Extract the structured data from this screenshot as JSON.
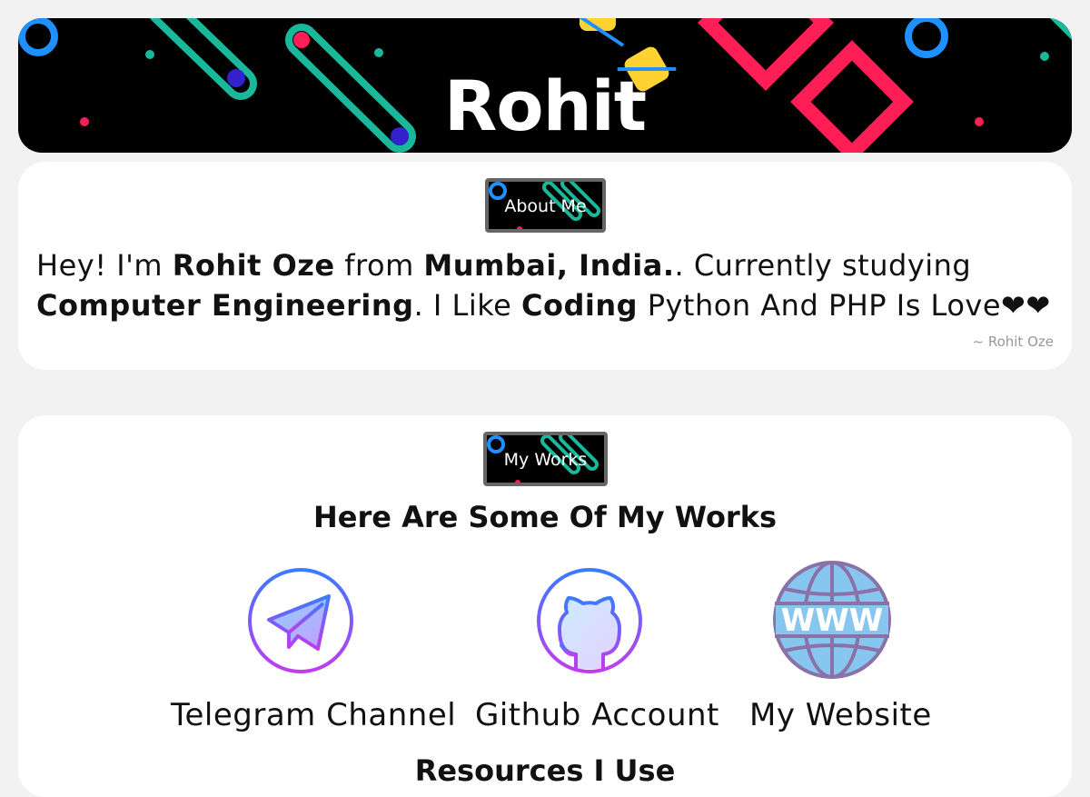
{
  "banner": {
    "title": "Rohit"
  },
  "about": {
    "badge_label": "About Me",
    "intro_1": "Hey! I'm ",
    "name": "Rohit Oze",
    "intro_2": " from ",
    "location": "Mumbai, India.",
    "intro_3": ". Currently studying ",
    "study": "Computer Engineering",
    "intro_4": ". I Like ",
    "hobby": "Coding",
    "intro_5": " Python And PHP Is Love❤❤",
    "signature": "~ Rohit Oze"
  },
  "works": {
    "badge_label": "My Works",
    "heading": "Here Are Some Of My Works",
    "items": [
      {
        "label": "Telegram Channel",
        "icon": "telegram-icon"
      },
      {
        "label": "Github Account",
        "icon": "github-icon"
      },
      {
        "label": "My Website",
        "icon": "www-globe-icon"
      }
    ],
    "resources_heading": "Resources I Use"
  },
  "colors": {
    "banner_bg": "#000000",
    "teal": "#1ab89a",
    "pink": "#ff1e56",
    "blue": "#1e90ff",
    "yellow": "#ffd233",
    "page_bg": "#f2f2f2"
  }
}
